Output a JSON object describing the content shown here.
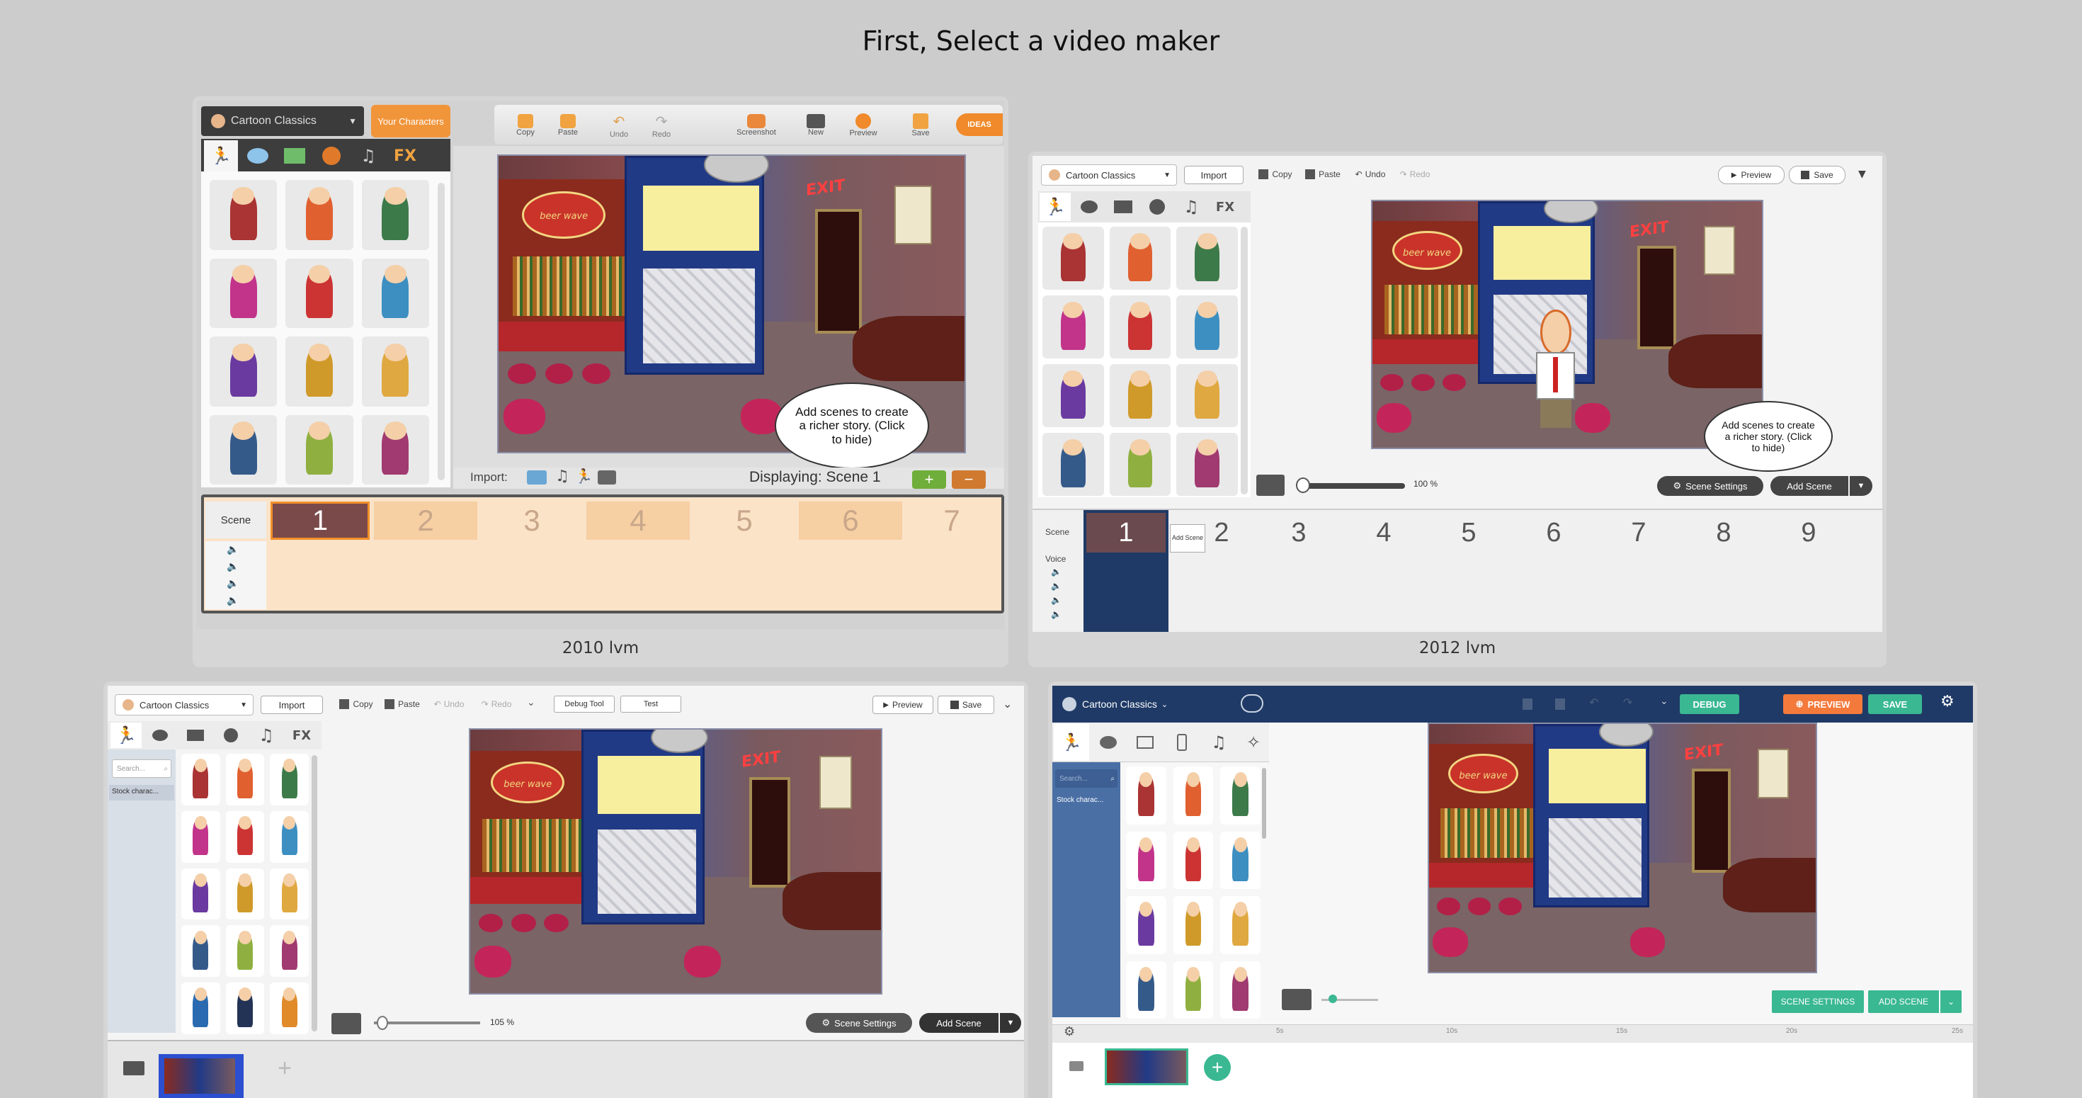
{
  "page": {
    "title": "First, Select a video maker"
  },
  "makers": [
    {
      "caption": "2010 lvm",
      "theme_dropdown": "Cartoon Classics",
      "your_characters": "Your Characters",
      "toolbar": [
        "Copy",
        "Paste",
        "Undo",
        "Redo",
        "Screenshot",
        "New",
        "Preview",
        "Save"
      ],
      "ideas": "IDEAS",
      "tabs_fx": "FX",
      "import_label": "Import:",
      "displaying": "Displaying: Scene 1",
      "bubble": "Add scenes to create a richer story. (Click to hide)",
      "timeline_scene": "Scene",
      "scene_numbers": [
        "1",
        "2",
        "3",
        "4",
        "5",
        "6",
        "7"
      ]
    },
    {
      "caption": "2012 lvm",
      "theme_dropdown": "Cartoon Classics",
      "import": "Import",
      "toolbar": [
        "Copy",
        "Paste",
        "Undo",
        "Redo"
      ],
      "preview": "Preview",
      "save": "Save",
      "tabs_fx": "FX",
      "zoom": "100 %",
      "scene_settings": "Scene Settings",
      "add_scene": "Add Scene",
      "bubble": "Add scenes to create a richer story. (Click to hide)",
      "timeline_scene": "Scene",
      "timeline_voice": "Voice",
      "add_scene_small": "Add Scene",
      "scene_numbers": [
        "1",
        "2",
        "3",
        "4",
        "5",
        "6",
        "7",
        "8",
        "9"
      ]
    },
    {
      "theme_dropdown": "Cartoon Classics",
      "import": "Import",
      "toolbar": [
        "Copy",
        "Paste",
        "Undo",
        "Redo"
      ],
      "debug_tool": "Debug Tool",
      "test": "Test",
      "preview": "Preview",
      "save": "Save",
      "tabs_fx": "FX",
      "search_placeholder": "Search...",
      "stock": "Stock charac...",
      "zoom": "105 %",
      "scene_settings": "Scene Settings",
      "add_scene": "Add Scene"
    },
    {
      "theme_dropdown": "Cartoon Classics",
      "debug": "DEBUG",
      "preview": "PREVIEW",
      "save": "SAVE",
      "search_placeholder": "Search...",
      "stock": "Stock charac...",
      "scene_settings": "SCENE SETTINGS",
      "add_scene": "ADD SCENE",
      "ruler": [
        "5s",
        "10s",
        "15s",
        "20s",
        "25s"
      ]
    }
  ],
  "scene_art": {
    "sign": "beer wave",
    "exit": "EXIT"
  },
  "colors": {
    "bg": "#cccccc",
    "orange": "#f28f2a",
    "navy": "#1f3a66",
    "teal": "#3ab892",
    "blue_panel": "#4a6fa5"
  }
}
